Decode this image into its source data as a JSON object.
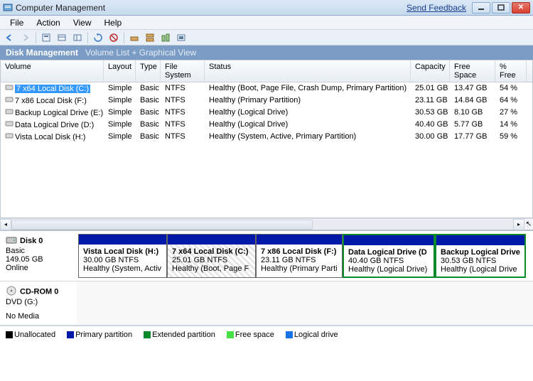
{
  "titlebar": {
    "title": "Computer Management",
    "feedback": "Send Feedback"
  },
  "menu": [
    "File",
    "Action",
    "View",
    "Help"
  ],
  "section": {
    "main": "Disk Management",
    "sub": "Volume List + Graphical View"
  },
  "columns": {
    "volume": "Volume",
    "layout": "Layout",
    "type": "Type",
    "fs": "File System",
    "status": "Status",
    "capacity": "Capacity",
    "free": "Free Space",
    "pct": "% Free"
  },
  "volumes": [
    {
      "name": "7 x64 Local Disk (C:)",
      "layout": "Simple",
      "type": "Basic",
      "fs": "NTFS",
      "status": "Healthy (Boot, Page File, Crash Dump, Primary Partition)",
      "capacity": "25.01 GB",
      "free": "13.47 GB",
      "pct": "54 %",
      "selected": true
    },
    {
      "name": "7 x86 Local Disk (F:)",
      "layout": "Simple",
      "type": "Basic",
      "fs": "NTFS",
      "status": "Healthy (Primary Partition)",
      "capacity": "23.11 GB",
      "free": "14.84 GB",
      "pct": "64 %"
    },
    {
      "name": "Backup Logical Drive (E:)",
      "layout": "Simple",
      "type": "Basic",
      "fs": "NTFS",
      "status": "Healthy (Logical Drive)",
      "capacity": "30.53 GB",
      "free": "8.10 GB",
      "pct": "27 %"
    },
    {
      "name": "Data Logical Drive (D:)",
      "layout": "Simple",
      "type": "Basic",
      "fs": "NTFS",
      "status": "Healthy (Logical Drive)",
      "capacity": "40.40 GB",
      "free": "5.77 GB",
      "pct": "14 %"
    },
    {
      "name": "Vista Local Disk (H:)",
      "layout": "Simple",
      "type": "Basic",
      "fs": "NTFS",
      "status": "Healthy (System, Active, Primary Partition)",
      "capacity": "30.00 GB",
      "free": "17.77 GB",
      "pct": "59 %"
    }
  ],
  "disk0": {
    "name": "Disk 0",
    "type": "Basic",
    "size": "149.05 GB",
    "state": "Online",
    "parts": [
      {
        "label": "Vista Local Disk  (H:)",
        "size": "30.00 GB NTFS",
        "status": "Healthy (System, Activ",
        "w": 125,
        "ext": false
      },
      {
        "label": "7 x64 Local Disk  (C:)",
        "size": "25.01 GB NTFS",
        "status": "Healthy (Boot, Page F",
        "w": 125,
        "ext": false,
        "hatch": true
      },
      {
        "label": "7 x86 Local Disk  (F:)",
        "size": "23.11 GB NTFS",
        "status": "Healthy (Primary Parti",
        "w": 122,
        "ext": false
      },
      {
        "label": "Data Logical Drive  (D",
        "size": "40.40 GB NTFS",
        "status": "Healthy (Logical Drive)",
        "w": 130,
        "ext": true
      },
      {
        "label": "Backup Logical Drive",
        "size": "30.53 GB NTFS",
        "status": "Healthy (Logical Drive",
        "w": 128,
        "ext": true
      }
    ]
  },
  "cdrom": {
    "name": "CD-ROM 0",
    "type": "DVD (G:)",
    "state": "No Media"
  },
  "legend": {
    "unalloc": "Unallocated",
    "primary": "Primary partition",
    "extended": "Extended partition",
    "free": "Free space",
    "logical": "Logical drive"
  }
}
